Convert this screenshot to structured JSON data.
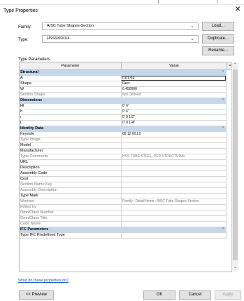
{
  "dialog": {
    "title": "Type Properties",
    "close_glyph": "✕"
  },
  "family": {
    "label": "Family:",
    "value": "AISC Tube Shapes-Section",
    "load_button": "Load..."
  },
  "type": {
    "label": "Type:",
    "value": "HSS6X6X1/4",
    "duplicate_button": "Duplicate...",
    "rename_button": "Rename..."
  },
  "type_parameters": {
    "label": "Type Parameters",
    "col_parameter": "Parameter",
    "col_value": "Value",
    "col_extra": "=",
    "rows": [
      {
        "kind": "group",
        "name": "Structural",
        "toggle": "⌃"
      },
      {
        "kind": "param",
        "name": "A",
        "value": "0.01 SF",
        "editing": true
      },
      {
        "kind": "param",
        "name": "Shape",
        "value": "Rect."
      },
      {
        "kind": "param",
        "name": "W",
        "value": "6.450000"
      },
      {
        "kind": "ro",
        "name": "Section Shape",
        "value": "Not Defined"
      },
      {
        "kind": "group",
        "name": "Dimensions",
        "toggle": "⌃"
      },
      {
        "kind": "param",
        "name": "Ht",
        "value": "0'  6\""
      },
      {
        "kind": "param",
        "name": "b",
        "value": "0'  6\""
      },
      {
        "kind": "param",
        "name": "r",
        "value": "0'  0 1/2\""
      },
      {
        "kind": "param",
        "name": "t",
        "value": "0'  0 1/4\""
      },
      {
        "kind": "group",
        "name": "Identity Data",
        "toggle": "⌃"
      },
      {
        "kind": "param",
        "name": "Keynote",
        "value": "05 12 00.L0"
      },
      {
        "kind": "ro",
        "name": "Type Image",
        "value": ""
      },
      {
        "kind": "param",
        "name": "Model",
        "value": ""
      },
      {
        "kind": "param",
        "name": "Manufacturer",
        "value": ""
      },
      {
        "kind": "ro",
        "name": "Type Comments",
        "value": "HSS TUBE STEEL, PER STRUCTURAL"
      },
      {
        "kind": "param",
        "name": "URL",
        "value": ""
      },
      {
        "kind": "param",
        "name": "Description",
        "value": ""
      },
      {
        "kind": "param",
        "name": "Assembly Code",
        "value": ""
      },
      {
        "kind": "param",
        "name": "Cost",
        "value": ""
      },
      {
        "kind": "ro",
        "name": "Section Name Key",
        "value": ""
      },
      {
        "kind": "ro",
        "name": "Assembly Description",
        "value": ""
      },
      {
        "kind": "param",
        "name": "Type Mark",
        "value": ""
      },
      {
        "kind": "ro",
        "name": "Workset",
        "value": "Family : Detail Items : AISC Tube Shapes-Section"
      },
      {
        "kind": "ro",
        "name": "Edited by",
        "value": ""
      },
      {
        "kind": "ro",
        "name": "OmniClass Number",
        "value": ""
      },
      {
        "kind": "ro",
        "name": "OmniClass Title",
        "value": ""
      },
      {
        "kind": "ro",
        "name": "Code Name",
        "value": ""
      },
      {
        "kind": "group",
        "name": "IFC Parameters",
        "toggle": "⌃"
      },
      {
        "kind": "param",
        "name": "Type IFC Predefined Type",
        "value": ""
      }
    ]
  },
  "footer": {
    "help_link": "What do these properties do?",
    "preview_button": "<< Preview",
    "ok_button": "OK",
    "cancel_button": "Cancel",
    "apply_button": "Apply"
  },
  "colors": {
    "group_header": "#c6d7ea",
    "highlight": "#ffff46",
    "link": "#1a56c8"
  }
}
